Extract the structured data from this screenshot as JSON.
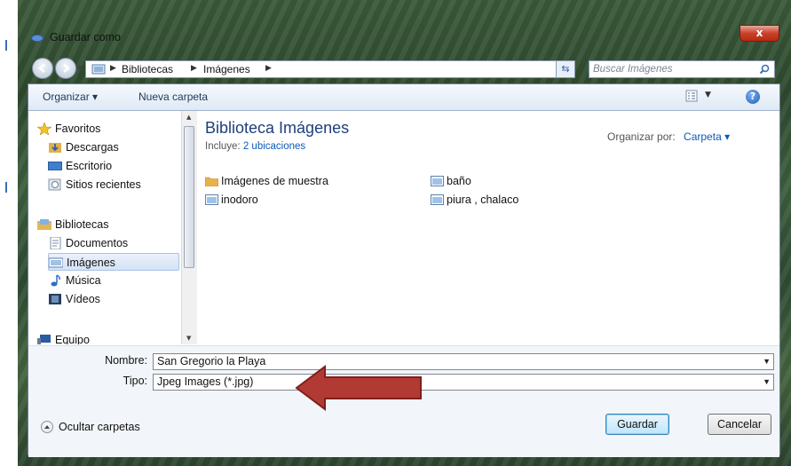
{
  "window": {
    "title": "Guardar como",
    "close_label": "x"
  },
  "address": {
    "crumbs": [
      "Bibliotecas",
      "Imágenes"
    ],
    "search_placeholder": "Buscar Imágenes"
  },
  "toolbar": {
    "organize_label": "Organizar ▾",
    "new_folder_label": "Nueva carpeta"
  },
  "sidebar": {
    "favorites_label": "Favoritos",
    "favorites": [
      "Descargas",
      "Escritorio",
      "Sitios recientes"
    ],
    "libraries_label": "Bibliotecas",
    "libraries": [
      "Documentos",
      "Imágenes",
      "Música",
      "Vídeos"
    ],
    "computer_label": "Equipo",
    "selected": "Imágenes"
  },
  "library": {
    "title": "Biblioteca Imágenes",
    "includes_prefix": "Incluye:",
    "includes_link": "2 ubicaciones",
    "arrange_label": "Organizar por:",
    "arrange_value": "Carpeta ▾"
  },
  "files": [
    {
      "name": "Imágenes de muestra",
      "kind": "folder"
    },
    {
      "name": "baño",
      "kind": "image"
    },
    {
      "name": "inodoro",
      "kind": "image"
    },
    {
      "name": "piura , chalaco",
      "kind": "image"
    }
  ],
  "save": {
    "name_label": "Nombre:",
    "name_value": "San Gregorio la Playa",
    "type_label": "Tipo:",
    "type_value": "Jpeg Images (*.jpg)",
    "hide_folders_label": "Ocultar carpetas",
    "save_label": "Guardar",
    "cancel_label": "Cancelar"
  },
  "colors": {
    "arrow": "#b23a34",
    "accent": "#1e3f7a",
    "link": "#0c5ab8"
  }
}
